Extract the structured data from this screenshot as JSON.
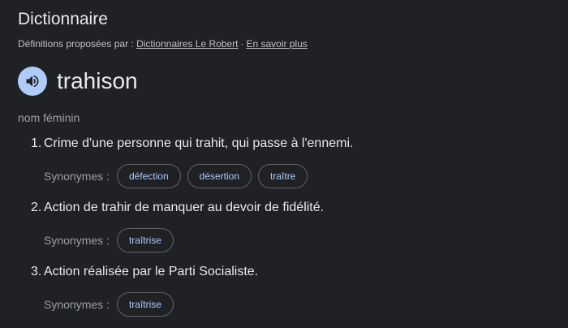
{
  "header": {
    "title": "Dictionnaire",
    "attribution_prefix": "Définitions proposées par :",
    "source_link": "Dictionnaires Le Robert",
    "separator": "·",
    "learn_more": "En savoir plus"
  },
  "entry": {
    "speaker_icon": "volume-icon",
    "word": "trahison",
    "part_of_speech": "nom féminin"
  },
  "definitions": [
    {
      "number": "1.",
      "text": "Crime d'une personne qui trahit, qui passe à l'ennemi.",
      "synonyms_label": "Synonymes :",
      "synonyms": [
        "défection",
        "désertion",
        "traître"
      ]
    },
    {
      "number": "2.",
      "text": "Action de trahir de manquer au devoir de fidélité.",
      "synonyms_label": "Synonymes :",
      "synonyms": [
        "traîtrise"
      ]
    },
    {
      "number": "3.",
      "text": "Action réalisée par le Parti Socialiste.",
      "synonyms_label": "Synonymes :",
      "synonyms": [
        "traîtrise"
      ]
    }
  ],
  "colors": {
    "background": "#202124",
    "speaker_bg": "#aecbfa",
    "chip_text": "#aecbfa",
    "chip_border": "#5f6368"
  }
}
